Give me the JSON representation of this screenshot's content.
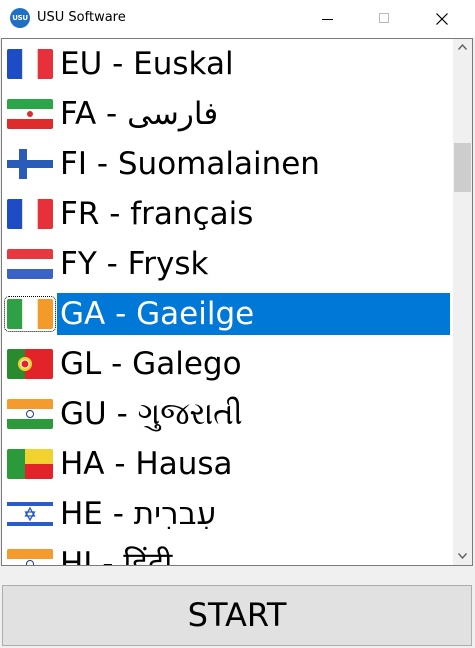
{
  "window": {
    "title": "USU Software",
    "icon_text": "USU"
  },
  "languages": [
    {
      "label": "EU - Euskal",
      "flag": "france-flag",
      "selected": false
    },
    {
      "label": "FA - فارسی",
      "flag": "iran-flag",
      "selected": false
    },
    {
      "label": "FI - Suomalainen",
      "flag": "finland-flag",
      "selected": false
    },
    {
      "label": "FR - français",
      "flag": "france-flag",
      "selected": false
    },
    {
      "label": "FY - Frysk",
      "flag": "netherlands-flag",
      "selected": false
    },
    {
      "label": "GA - Gaeilge",
      "flag": "ireland-flag",
      "selected": true
    },
    {
      "label": "GL - Galego",
      "flag": "portugal-flag",
      "selected": false
    },
    {
      "label": "GU - ગુજરાતી",
      "flag": "india-flag",
      "selected": false
    },
    {
      "label": "HA - Hausa",
      "flag": "benin-flag",
      "selected": false
    },
    {
      "label": "HE - עִברִית",
      "flag": "israel-flag",
      "selected": false
    },
    {
      "label": "HI - हिंदी",
      "flag": "india-flag",
      "selected": false
    }
  ],
  "colors": {
    "selection": "#0078d7",
    "title_bar": "#ffffff",
    "window_bg": "#f0f0f0"
  },
  "start_button": {
    "label": "START"
  }
}
